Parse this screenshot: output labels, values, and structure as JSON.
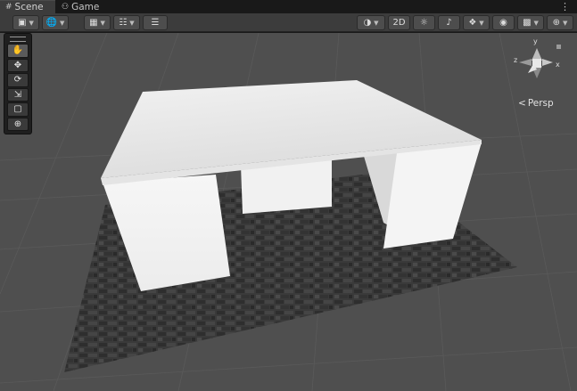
{
  "tabs": [
    {
      "label": "Scene",
      "icon": "hash-icon"
    },
    {
      "label": "Game",
      "icon": "gamepad-icon"
    }
  ],
  "toolbar": {
    "toggle_2d_label": "2D"
  },
  "tools": [
    "hand-tool",
    "move-tool",
    "rotate-tool",
    "scale-tool",
    "rect-tool",
    "transform-tool"
  ],
  "gizmo": {
    "axis_y": "y",
    "axis_x": "x",
    "axis_z": "z",
    "projection_label": "Persp"
  },
  "colors": {
    "editor_bg": "#191919",
    "toolbar_bg": "#3c3c3c",
    "viewport_bg": "#4f4f4f"
  }
}
